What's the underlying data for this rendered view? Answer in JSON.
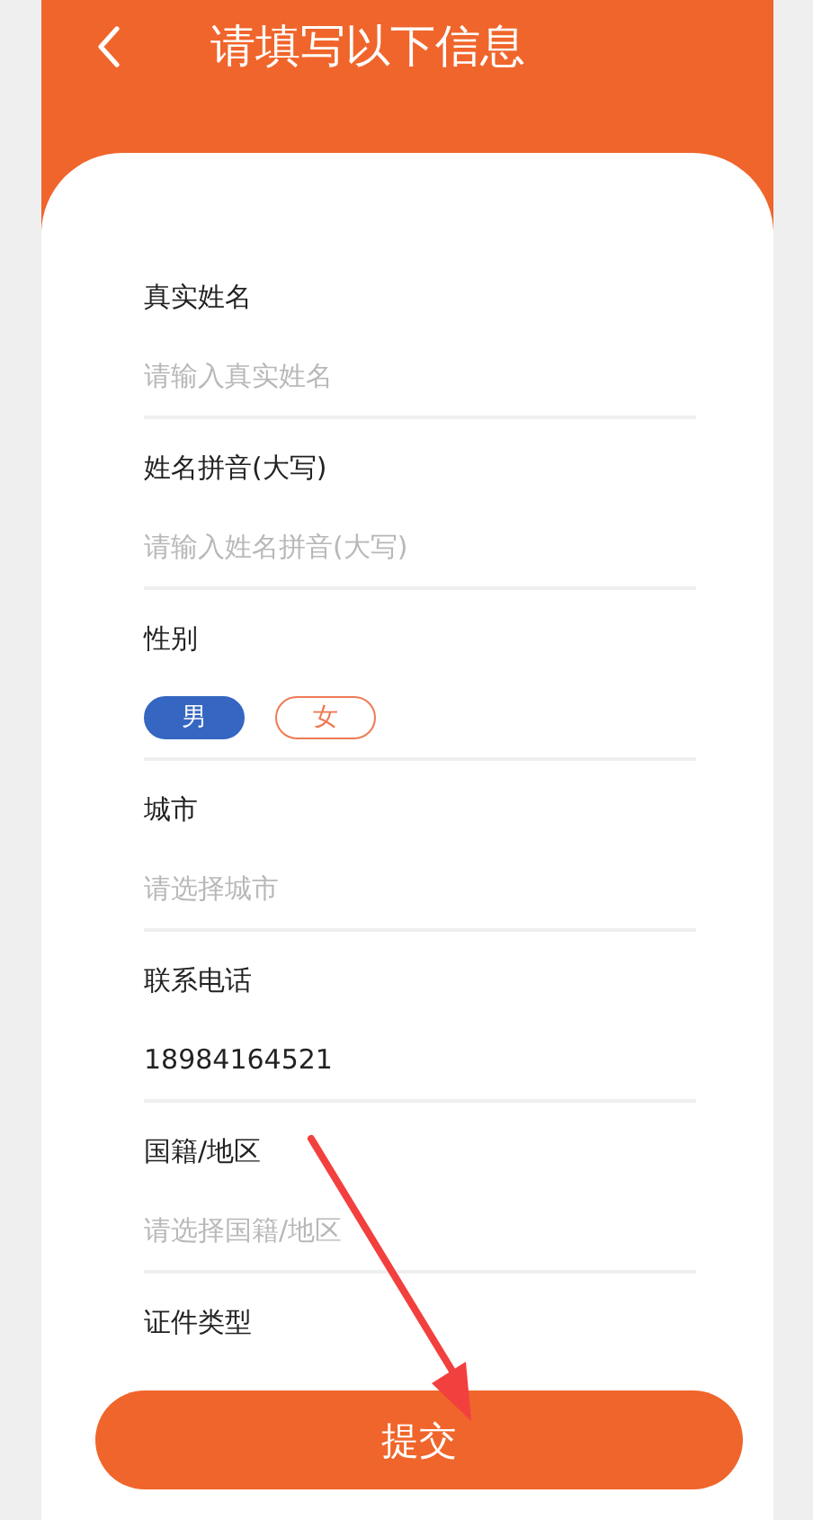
{
  "header": {
    "title": "请填写以下信息"
  },
  "fields": [
    {
      "kind": "input",
      "label": "真实姓名",
      "placeholder": "请输入真实姓名"
    },
    {
      "kind": "input",
      "label": "姓名拼音(大写)",
      "placeholder": "请输入姓名拼音(大写)"
    },
    {
      "kind": "gender",
      "label": "性别",
      "options": [
        {
          "label": "男",
          "selected": true
        },
        {
          "label": "女",
          "selected": false
        }
      ]
    },
    {
      "kind": "select",
      "label": "城市",
      "placeholder": "请选择城市"
    },
    {
      "kind": "input",
      "label": "联系电话",
      "value": "18984164521"
    },
    {
      "kind": "select",
      "label": "国籍/地区",
      "placeholder": "请选择国籍/地区"
    },
    {
      "kind": "select",
      "label": "证件类型"
    }
  ],
  "submit_button": "提交"
}
